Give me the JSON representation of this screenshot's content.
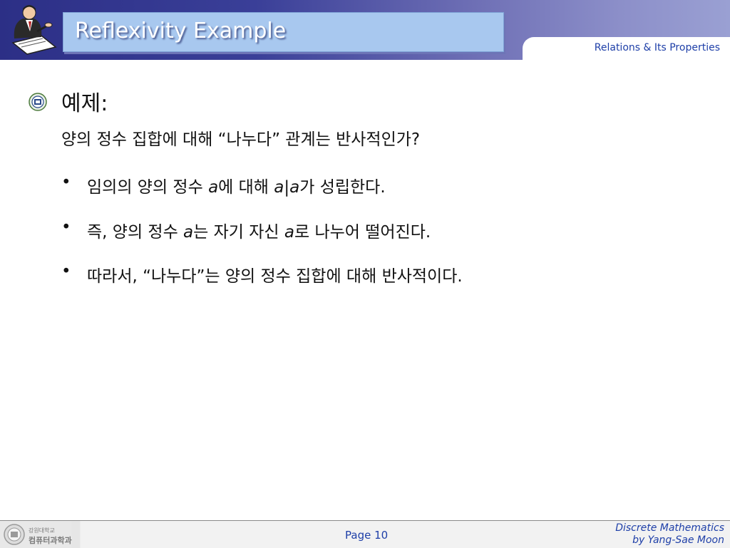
{
  "header": {
    "title": "Reflexivity Example",
    "section_tab": "Relations & Its Properties"
  },
  "content": {
    "heading": "예제:",
    "question": "양의 정수 집합에 대해 “나누다” 관계는 반사적인가?",
    "bullets": [
      {
        "pre": "임의의 양의 정수 ",
        "v1": "a",
        "mid": "에 대해 ",
        "v2": "a|a",
        "post": "가 성립한다."
      },
      {
        "pre": "즉, 양의 정수 ",
        "v1": "a",
        "mid": "는 자기 자신 ",
        "v2": "a",
        "post": "로 나누어 떨어진다."
      },
      {
        "text": "따라서, “나누다”는 양의 정수 집합에 대해 반사적이다."
      }
    ],
    "bullet_symbol": "•"
  },
  "footer": {
    "dept_line1": "강원대학교",
    "dept_line2": "컴퓨터과학과",
    "page": "Page 10",
    "credit_line1": "Discrete Mathematics",
    "credit_line2": "by Yang-Sae Moon"
  },
  "colors": {
    "header_dark": "#2c2f86",
    "header_light": "#9aa0d3",
    "title_box": "#a8c8ef",
    "accent_text": "#1e3fa8"
  },
  "icons": {
    "header_logo": "writing-person-icon",
    "bullet": "university-seal-icon",
    "footer_logo": "university-seal-icon"
  }
}
